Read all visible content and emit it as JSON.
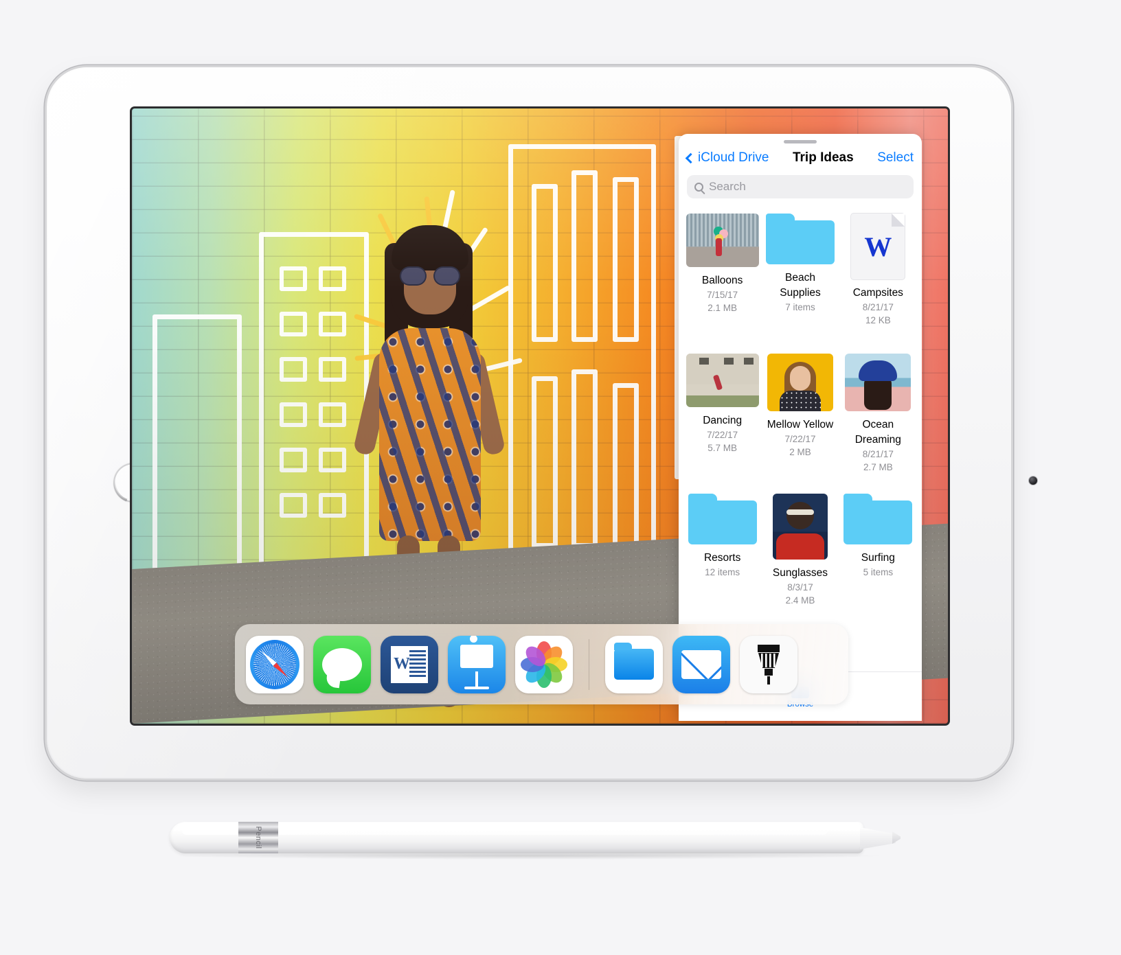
{
  "device": {
    "name": "iPad",
    "home_button": "home-button",
    "camera": "front-camera"
  },
  "files_app": {
    "grabber": "drag-handle",
    "nav": {
      "back_label": "iCloud Drive",
      "title": "Trip Ideas",
      "select_label": "Select"
    },
    "search": {
      "placeholder": "Search",
      "value": ""
    },
    "items": [
      {
        "name": "Balloons",
        "date": "7/15/17",
        "size": "2.1 MB",
        "kind": "photo"
      },
      {
        "name": "Beach Supplies",
        "date": "",
        "size": "7 items",
        "kind": "folder"
      },
      {
        "name": "Campsites",
        "date": "8/21/17",
        "size": "12 KB",
        "kind": "word"
      },
      {
        "name": "Dancing",
        "date": "7/22/17",
        "size": "5.7 MB",
        "kind": "photo"
      },
      {
        "name": "Mellow Yellow",
        "date": "7/22/17",
        "size": "2 MB",
        "kind": "photo"
      },
      {
        "name": "Ocean Dreaming",
        "date": "8/21/17",
        "size": "2.7 MB",
        "kind": "photo"
      },
      {
        "name": "Resorts",
        "date": "",
        "size": "12 items",
        "kind": "folder"
      },
      {
        "name": "Sunglasses",
        "date": "8/3/17",
        "size": "2.4 MB",
        "kind": "photo"
      },
      {
        "name": "Surfing",
        "date": "",
        "size": "5 items",
        "kind": "folder"
      }
    ],
    "tabbar": [
      {
        "label": "Browse",
        "icon": "folder-icon"
      }
    ],
    "accent_color": "#0a7cff",
    "folder_color": "#5ccdf6"
  },
  "dock": {
    "apps": [
      {
        "label": "Safari",
        "icon": "safari-icon"
      },
      {
        "label": "Messages",
        "icon": "messages-icon"
      },
      {
        "label": "Word",
        "icon": "word-icon"
      },
      {
        "label": "Keynote",
        "icon": "keynote-icon"
      },
      {
        "label": "Photos",
        "icon": "photos-icon"
      }
    ],
    "recents": [
      {
        "label": "Files",
        "icon": "files-icon"
      },
      {
        "label": "Mail",
        "icon": "mail-icon"
      },
      {
        "label": "Brush",
        "icon": "brush-icon"
      }
    ]
  },
  "wallpaper": {
    "description": "Woman standing against rainbow gradient brick wall with white marker doodles"
  },
  "accessory": {
    "name": "Apple Pencil",
    "band_text": "Pencil"
  }
}
